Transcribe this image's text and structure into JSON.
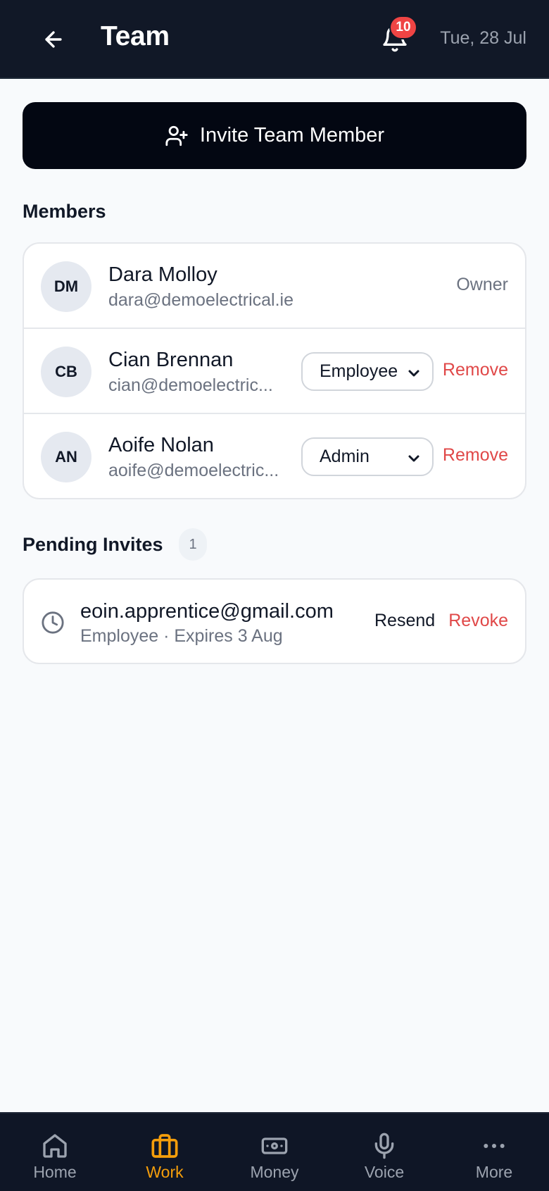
{
  "header": {
    "title": "Team",
    "notification_count": "10",
    "date": "Tue, 28 Jul"
  },
  "invite_button": {
    "label": "Invite Team Member"
  },
  "members": {
    "title": "Members",
    "items": [
      {
        "initials": "DM",
        "name": "Dara Molloy",
        "email": "dara@demoelectrical.ie",
        "role": "Owner"
      },
      {
        "initials": "CB",
        "name": "Cian Brennan",
        "email": "cian@demoelectric...",
        "role": "Employee",
        "action": "Remove"
      },
      {
        "initials": "AN",
        "name": "Aoife Nolan",
        "email": "aoife@demoelectric...",
        "role": "Admin",
        "action": "Remove"
      }
    ]
  },
  "pending": {
    "title": "Pending Invites",
    "count": "1",
    "items": [
      {
        "email": "eoin.apprentice@gmail.com",
        "meta": "Employee · Expires 3 Aug",
        "resend": "Resend",
        "revoke": "Revoke"
      }
    ]
  },
  "nav": {
    "items": [
      {
        "label": "Home",
        "icon": "home-icon",
        "active": false
      },
      {
        "label": "Work",
        "icon": "briefcase-icon",
        "active": true
      },
      {
        "label": "Money",
        "icon": "banknote-icon",
        "active": false
      },
      {
        "label": "Voice",
        "icon": "microphone-icon",
        "active": false
      },
      {
        "label": "More",
        "icon": "more-dots-icon",
        "active": false
      }
    ]
  },
  "colors": {
    "header_bg": "#111827",
    "accent_active": "#f59e0b",
    "danger": "#e04848",
    "badge": "#ef4444"
  }
}
